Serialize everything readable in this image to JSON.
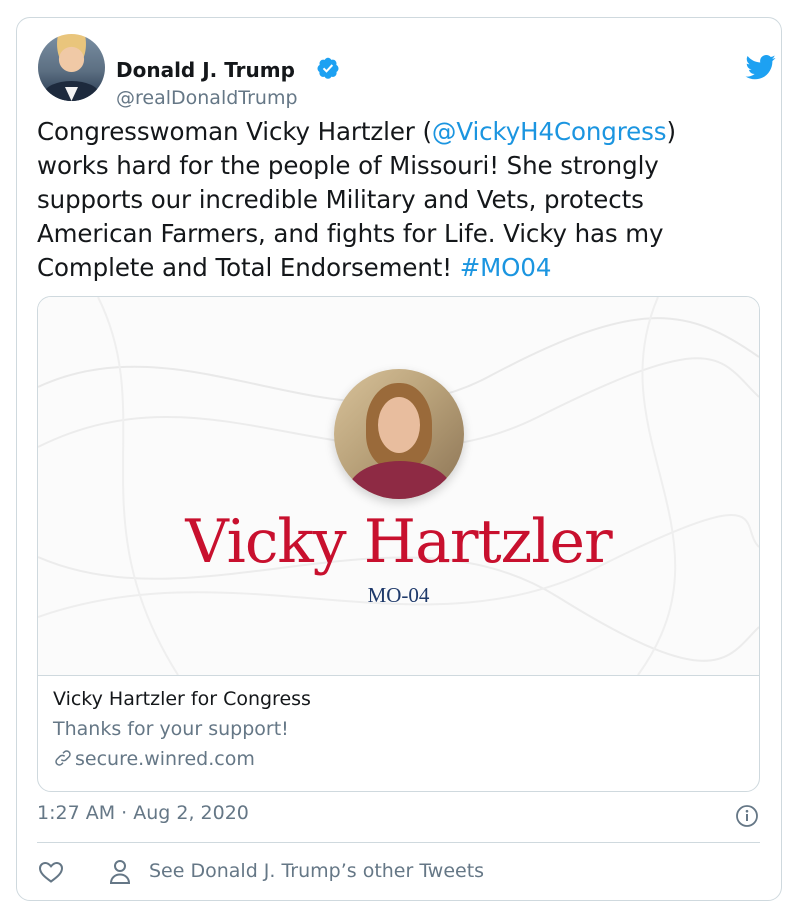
{
  "author": {
    "name": "Donald J. Trump",
    "handle": "@realDonaldTrump"
  },
  "tweet": {
    "line1_prefix": "Congresswoman Vicky Hartzler (",
    "mention": "@VickyH4Congress",
    "line1_suffix": ")",
    "line2": "works hard for the people of Missouri! She strongly",
    "line3": "supports our incredible Military and Vets, protects",
    "line4": "American Farmers, and fights for Life. Vicky has my",
    "line5_text": "Complete and Total Endorsement! ",
    "hashtag": "#MO04"
  },
  "card": {
    "image_name": "Vicky Hartzler",
    "image_district": "MO-04",
    "title": "Vicky Hartzler for Congress",
    "description": "Thanks for your support!",
    "domain": "secure.winred.com"
  },
  "meta": {
    "timestamp": "1:27 AM · Aug 2, 2020",
    "other_tweets": "See Donald J. Trump’s other Tweets"
  },
  "colors": {
    "link": "#1b95e0",
    "text": "#14171a",
    "secondary": "#657786",
    "border": "#cfd9de",
    "card_name": "#c8102e",
    "card_district": "#1f3a6b"
  },
  "icons": [
    "verified-badge-icon",
    "twitter-bird-icon",
    "link-icon",
    "info-icon",
    "heart-icon",
    "person-icon"
  ]
}
